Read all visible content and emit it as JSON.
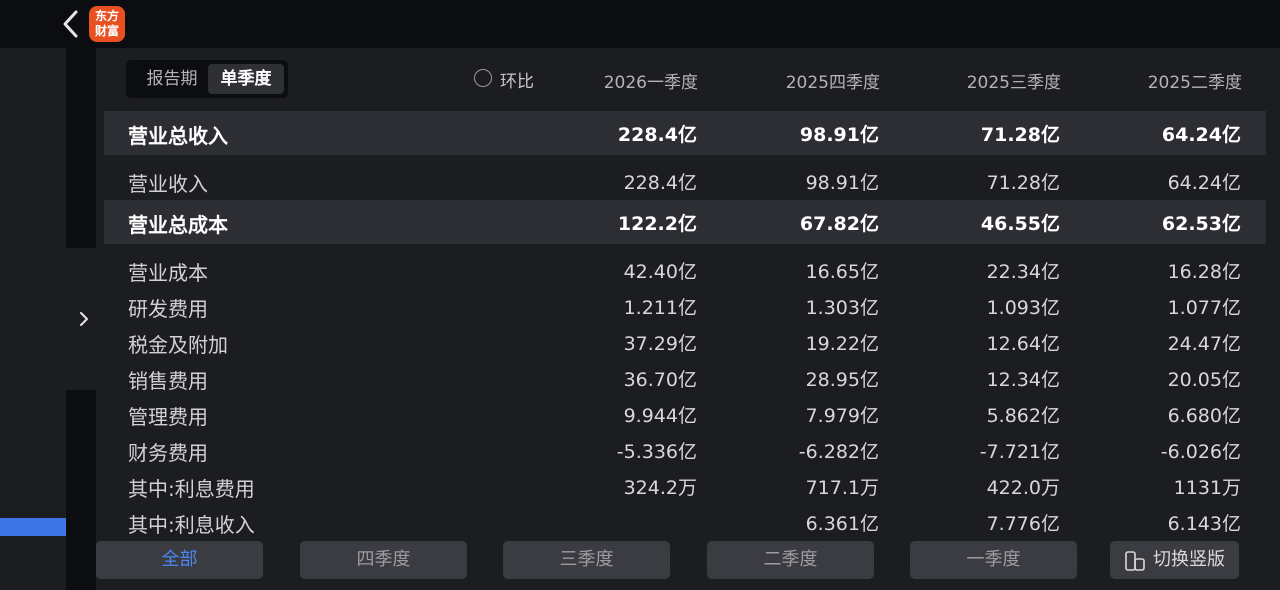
{
  "app": {
    "logo_line1": "东方",
    "logo_line2": "财富"
  },
  "icons": {
    "back": "chevron-left-icon",
    "expand": "chevron-right-icon",
    "switch": "switch-orientation-icon"
  },
  "colors": {
    "accent": "#4a87f0",
    "brand": "#e8501f",
    "background": "#1c1d21"
  },
  "segment": {
    "options": [
      "报告期",
      "单季度"
    ],
    "selected": "单季度"
  },
  "compare": {
    "label": "环比",
    "checked": false
  },
  "columns": [
    "2026一季度",
    "2025四季度",
    "2025三季度",
    "2025二季度"
  ],
  "rows": [
    {
      "label": "营业总收入",
      "major": true,
      "values": [
        "228.4亿",
        "98.91亿",
        "71.28亿",
        "64.24亿"
      ]
    },
    {
      "label": "营业收入",
      "major": false,
      "values": [
        "228.4亿",
        "98.91亿",
        "71.28亿",
        "64.24亿"
      ]
    },
    {
      "label": "营业总成本",
      "major": true,
      "values": [
        "122.2亿",
        "67.82亿",
        "46.55亿",
        "62.53亿"
      ]
    },
    {
      "label": "营业成本",
      "major": false,
      "values": [
        "42.40亿",
        "16.65亿",
        "22.34亿",
        "16.28亿"
      ]
    },
    {
      "label": "研发费用",
      "major": false,
      "values": [
        "1.211亿",
        "1.303亿",
        "1.093亿",
        "1.077亿"
      ]
    },
    {
      "label": "税金及附加",
      "major": false,
      "values": [
        "37.29亿",
        "19.22亿",
        "12.64亿",
        "24.47亿"
      ]
    },
    {
      "label": "销售费用",
      "major": false,
      "values": [
        "36.70亿",
        "28.95亿",
        "12.34亿",
        "20.05亿"
      ]
    },
    {
      "label": "管理费用",
      "major": false,
      "values": [
        "9.944亿",
        "7.979亿",
        "5.862亿",
        "6.680亿"
      ]
    },
    {
      "label": "财务费用",
      "major": false,
      "values": [
        "-5.336亿",
        "-6.282亿",
        "-7.721亿",
        "-6.026亿"
      ]
    },
    {
      "label": "其中:利息费用",
      "major": false,
      "values": [
        "324.2万",
        "717.1万",
        "422.0万",
        "1131万"
      ]
    },
    {
      "label": "其中:利息收入",
      "major": false,
      "values": [
        "",
        "6.361亿",
        "7.776亿",
        "6.143亿"
      ]
    }
  ],
  "tabs": [
    {
      "label": "全部",
      "active": true
    },
    {
      "label": "四季度",
      "active": false
    },
    {
      "label": "三季度",
      "active": false
    },
    {
      "label": "二季度",
      "active": false
    },
    {
      "label": "一季度",
      "active": false
    }
  ],
  "switch_button": {
    "label": "切换竖版"
  }
}
